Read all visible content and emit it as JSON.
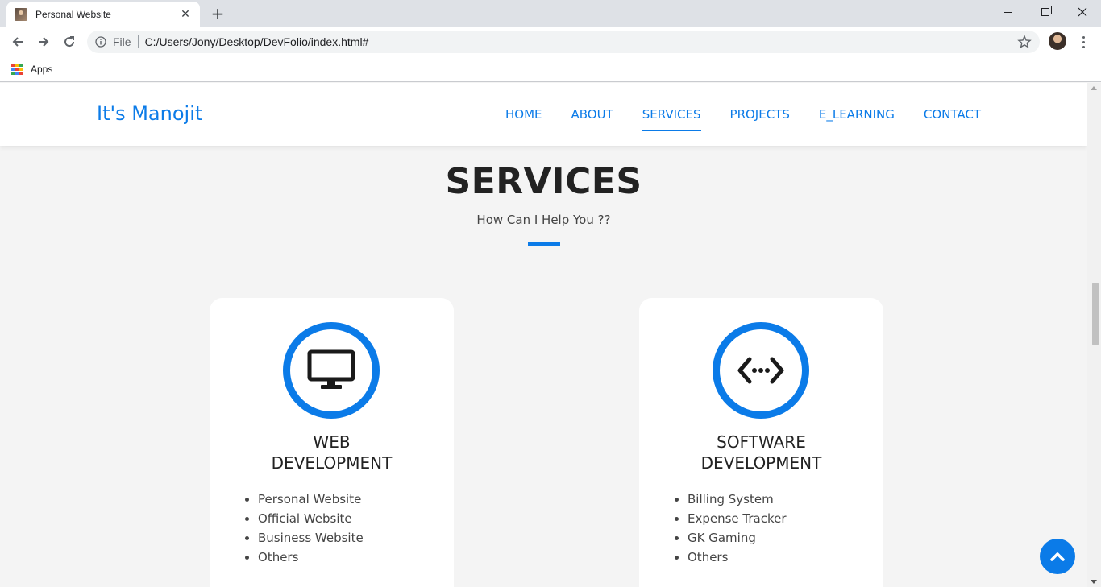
{
  "browser": {
    "tab_title": "Personal Website",
    "tab_close_glyph": "✕",
    "new_tab_glyph": "+",
    "scheme_label": "File",
    "url": "C:/Users/Jony/Desktop/DevFolio/index.html#",
    "bookmarks": {
      "apps_label": "Apps"
    }
  },
  "site": {
    "brand": "It's Manojit",
    "nav": [
      {
        "label": "HOME"
      },
      {
        "label": "ABOUT"
      },
      {
        "label": "SERVICES",
        "active": true
      },
      {
        "label": "PROJECTS"
      },
      {
        "label": "E_LEARNING"
      },
      {
        "label": "CONTACT"
      }
    ]
  },
  "services": {
    "title": "SERVICES",
    "subtitle": "How Can I Help You ??",
    "cards": [
      {
        "icon": "monitor-icon",
        "title_line1": "WEB",
        "title_line2": "DEVELOPMENT",
        "items": [
          "Personal Website",
          "Official Website",
          "Business Website",
          "Others"
        ]
      },
      {
        "icon": "code-icon",
        "title_line1": "SOFTWARE",
        "title_line2": "DEVELOPMENT",
        "items": [
          "Billing System",
          "Expense Tracker",
          "GK Gaming",
          "Others"
        ]
      }
    ]
  },
  "colors": {
    "accent": "#0b7be8",
    "heading": "#222222",
    "page_bg": "#f4f4f4",
    "card_bg": "#ffffff"
  }
}
